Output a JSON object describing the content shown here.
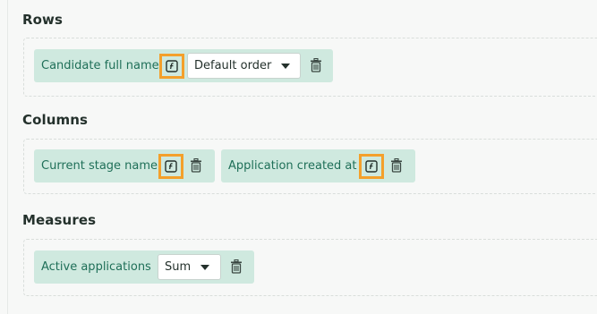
{
  "sections": [
    {
      "title": "Rows",
      "fields": [
        {
          "label": "Candidate full name",
          "select_value": "Default order"
        }
      ]
    },
    {
      "title": "Columns",
      "fields": [
        {
          "label": "Current stage name"
        },
        {
          "label": "Application created at"
        }
      ]
    },
    {
      "title": "Measures",
      "fields": [
        {
          "label": "Active applications",
          "select_value": "Sum"
        }
      ]
    }
  ],
  "icons": {
    "function": "function-icon",
    "trash": "trash-icon",
    "caret": "caret-down-icon"
  },
  "colors": {
    "pill_background": "#cfe9df",
    "pill_text": "#1f6f58",
    "highlight": "#f4a02b"
  }
}
